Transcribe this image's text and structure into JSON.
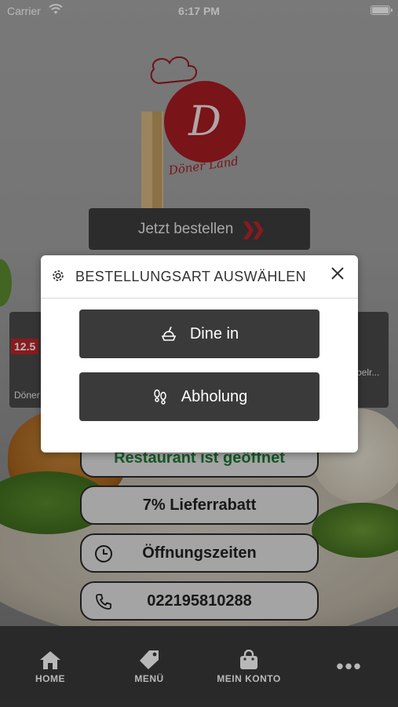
{
  "status_bar": {
    "carrier": "Carrier",
    "time": "6:17 PM"
  },
  "hero": {
    "order_button_label": "Jetzt bestellen",
    "logo_text": "Döner Land"
  },
  "carousel": {
    "left_card": {
      "price": "12.5",
      "label": "Döner"
    },
    "right_card": {
      "label": "belr..."
    }
  },
  "info_pills": {
    "open_status": "Restaurant ist geöffnet",
    "discount": "7% Lieferrabatt",
    "hours": "Öffnungszeiten",
    "phone": "022195810288"
  },
  "tab_bar": {
    "items": [
      {
        "label": "HOME",
        "icon": "home-icon"
      },
      {
        "label": "MENÜ",
        "icon": "tag-icon"
      },
      {
        "label": "MEIN KONTO",
        "icon": "bag-icon"
      },
      {
        "label": "•••",
        "icon": "more-icon"
      }
    ]
  },
  "modal": {
    "title": "BESTELLUNGSART AUSWÄHLEN",
    "options": [
      {
        "label": "Dine in",
        "icon": "dine-in-icon"
      },
      {
        "label": "Abholung",
        "icon": "footsteps-icon"
      }
    ]
  },
  "colors": {
    "accent_red": "#c0242b",
    "dark_button": "#3a3a3b",
    "open_green": "#1e7a34"
  }
}
